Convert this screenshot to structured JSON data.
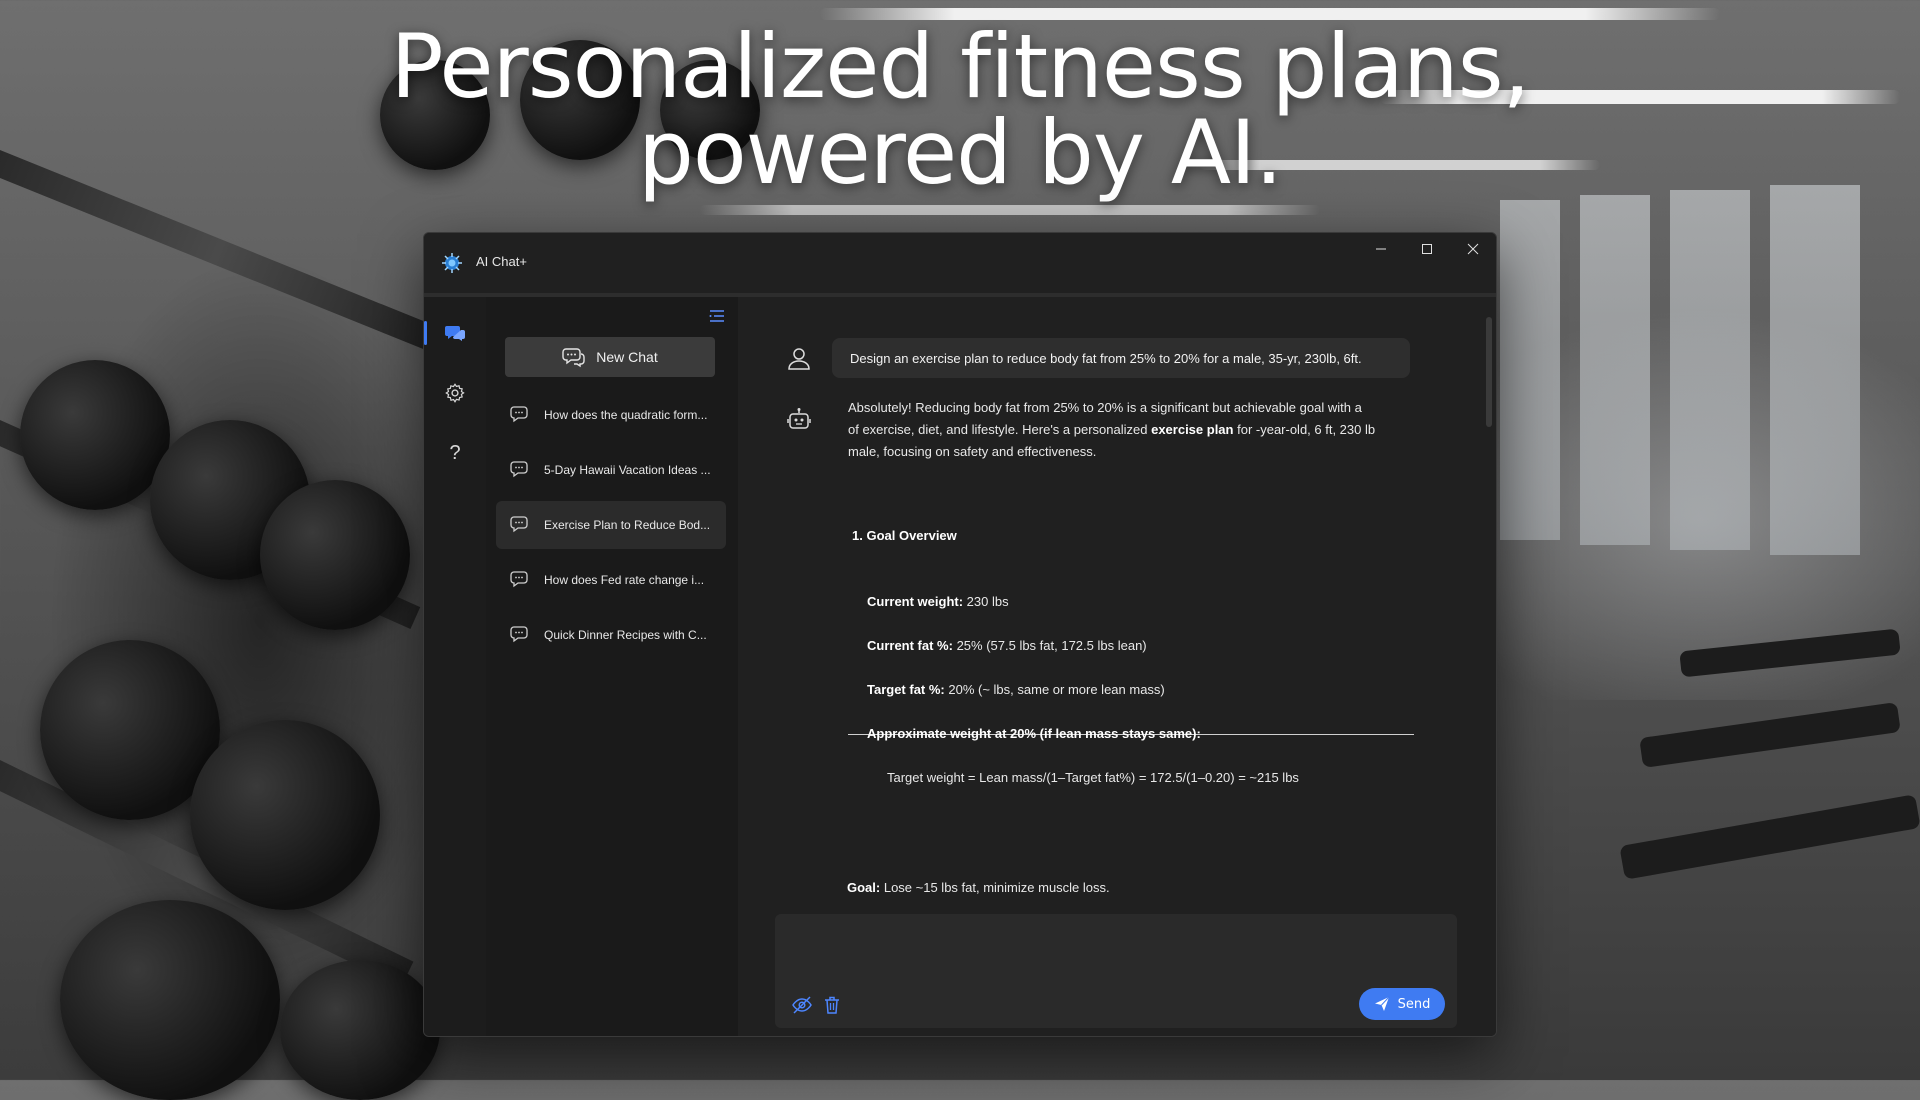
{
  "headline": {
    "line1": "Personalized fitness plans,",
    "line2": "powered by AI."
  },
  "window": {
    "title": "AI Chat+",
    "controls": {
      "minimize": "minimize-icon",
      "maximize": "maximize-icon",
      "close": "close-icon"
    }
  },
  "rail": {
    "items": [
      {
        "name": "chats",
        "icon": "chat-bubbles-icon",
        "active": true
      },
      {
        "name": "settings",
        "icon": "gear-icon",
        "active": false
      },
      {
        "name": "help",
        "icon": "help-icon",
        "label": "?",
        "active": false
      }
    ]
  },
  "sidebar": {
    "new_chat_label": "New Chat",
    "chats": [
      {
        "label": "How does the quadratic form..."
      },
      {
        "label": "5-Day Hawaii Vacation Ideas ..."
      },
      {
        "label": "Exercise Plan to Reduce Bod...",
        "active": true
      },
      {
        "label": "How does Fed rate change i..."
      },
      {
        "label": "Quick Dinner Recipes with C..."
      }
    ]
  },
  "conversation": {
    "user_message": "Design an exercise plan to reduce body fat from 25% to 20% for a male, 35-yr, 230lb, 6ft.",
    "ai_intro_part1": "Absolutely! Reducing body fat from 25% to 20% is a significant but achievable goal with a",
    "ai_intro_part2": "of exercise, diet, and lifestyle. Here's a personalized ",
    "ai_intro_bold": "exercise plan",
    "ai_intro_part3": " for -year-old, 6 ft, 230 lb",
    "ai_intro_part4": "male, focusing on safety and effectiveness.",
    "section_title": "1. Goal Overview",
    "current_weight_label": "Current weight:",
    "current_weight_value": " 230 lbs",
    "current_fat_label": "Current fat %:",
    "current_fat_value": " 25% (57.5 lbs fat, 172.5 lbs lean)",
    "target_fat_label": "Target fat %:",
    "target_fat_value": " 20% (~ lbs, same or more lean mass)",
    "approx_weight_label": "Approximate weight at 20% (if lean mass stays same):",
    "formula": "Target weight = Lean mass/(1–Target fat%) = 172.5/(1–0.20) = ~215 lbs",
    "goal_label": "Goal:",
    "goal_value": " Lose ~15 lbs fat, minimize muscle loss."
  },
  "composer": {
    "placeholder": "",
    "send_label": "Send",
    "icons": [
      "eye-off-icon",
      "trash-icon",
      "send-plane-icon"
    ]
  },
  "colors": {
    "accent": "#3f7bf2",
    "window_bg": "#202020",
    "sidebar_bg": "#1a1a1a",
    "bubble_bg": "#2e2e2e"
  }
}
